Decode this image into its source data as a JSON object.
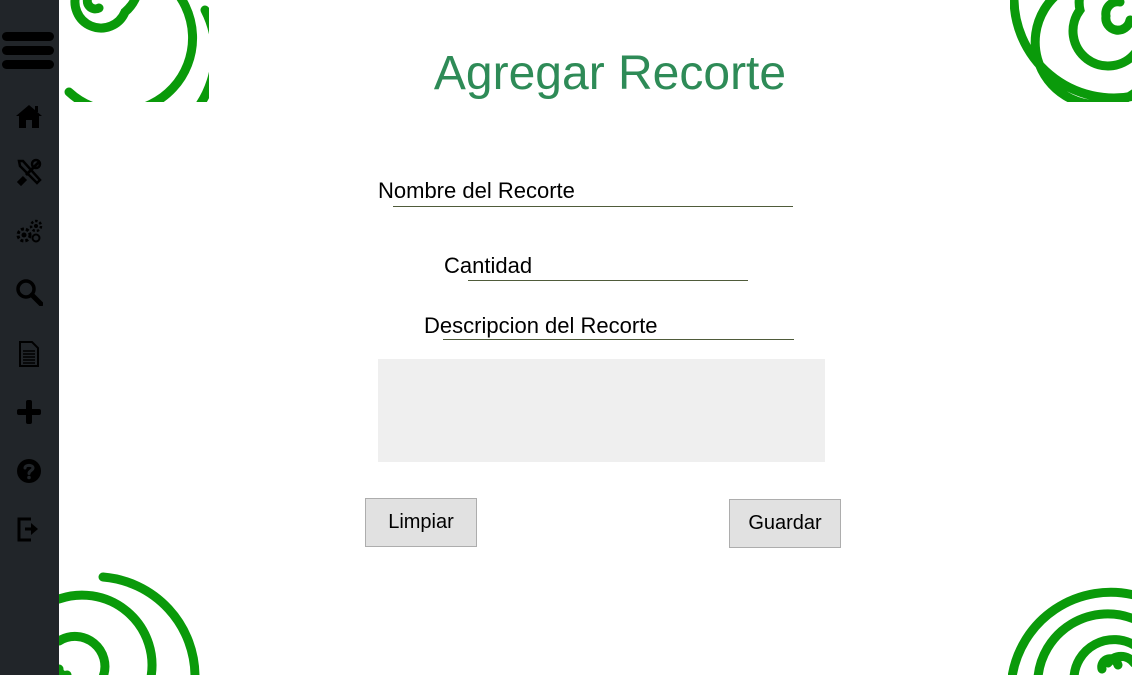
{
  "page": {
    "title": "Agregar Recorte"
  },
  "sidebar": {
    "menu_icon": "hamburger-menu-icon",
    "items": [
      {
        "name": "home",
        "icon": "home-icon"
      },
      {
        "name": "tools",
        "icon": "tools-icon"
      },
      {
        "name": "settings",
        "icon": "gears-icon"
      },
      {
        "name": "search",
        "icon": "search-icon"
      },
      {
        "name": "document",
        "icon": "document-icon"
      },
      {
        "name": "add",
        "icon": "plus-icon"
      },
      {
        "name": "help",
        "icon": "help-icon"
      },
      {
        "name": "logout",
        "icon": "logout-icon"
      }
    ]
  },
  "form": {
    "nombre_label": "Nombre del Recorte",
    "nombre_value": "",
    "cantidad_label": "Cantidad",
    "cantidad_value": "",
    "descripcion_label": "Descripcion del Recorte",
    "descripcion_value": "",
    "textarea_value": ""
  },
  "buttons": {
    "limpiar": "Limpiar",
    "guardar": "Guardar"
  },
  "colors": {
    "sidebar_bg": "#212529",
    "title_color": "#2e8b57",
    "spiral_color": "#0a9a0a",
    "textarea_bg": "#efefef",
    "button_bg": "#e1e1e1"
  }
}
